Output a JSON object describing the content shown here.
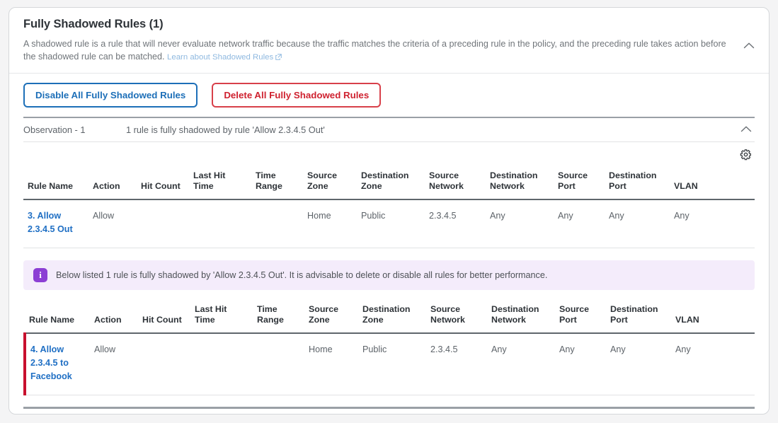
{
  "header": {
    "title": "Fully Shadowed Rules (1)",
    "description": "A shadowed rule is a rule that will never evaluate network traffic because the traffic matches the criteria of a preceding rule in the policy, and the preceding rule takes action before the shadowed rule can be matched.",
    "link_label": "Learn about Shadowed Rules",
    "collapse_icon": "chevron-up-icon"
  },
  "actions": {
    "disable_label": "Disable All Fully Shadowed Rules",
    "delete_label": "Delete All Fully Shadowed Rules"
  },
  "observation": {
    "label": "Observation - 1",
    "text": "1 rule is fully shadowed by rule 'Allow 2.3.4.5 Out'",
    "collapse_icon": "chevron-up-icon"
  },
  "toolbar": {
    "settings_icon": "gear-icon"
  },
  "columns": [
    "Rule Name",
    "Action",
    "Hit Count",
    "Last Hit Time",
    "Time Range",
    "Source Zone",
    "Destination Zone",
    "Source Network",
    "Destination Network",
    "Source Port",
    "Destination Port",
    "VLAN"
  ],
  "shadowing_table": {
    "rows": [
      {
        "rule_name": "3. Allow 2.3.4.5 Out",
        "action": "Allow",
        "hit_count": "",
        "last_hit_time": "",
        "time_range": "",
        "source_zone": "Home",
        "destination_zone": "Public",
        "source_network": "2.3.4.5",
        "destination_network": "Any",
        "source_port": "Any",
        "destination_port": "Any",
        "vlan": "Any"
      }
    ]
  },
  "info_banner": {
    "icon": "info-icon",
    "text": "Below listed 1 rule is fully shadowed by 'Allow 2.3.4.5 Out'. It is advisable to delete or disable all rules for better performance."
  },
  "shadowed_table": {
    "rows": [
      {
        "rule_name": "4. Allow 2.3.4.5 to Facebook",
        "action": "Allow",
        "hit_count": "",
        "last_hit_time": "",
        "time_range": "",
        "source_zone": "Home",
        "destination_zone": "Public",
        "source_network": "2.3.4.5",
        "destination_network": "Any",
        "source_port": "Any",
        "destination_port": "Any",
        "vlan": "Any"
      }
    ]
  },
  "colors": {
    "link_blue": "#1f6fc4",
    "button_blue": "#1d6fb8",
    "button_red": "#cf2230",
    "flag_red": "#c8102e",
    "info_purple": "#8c3fd4",
    "info_bg": "#f4ecfb"
  }
}
